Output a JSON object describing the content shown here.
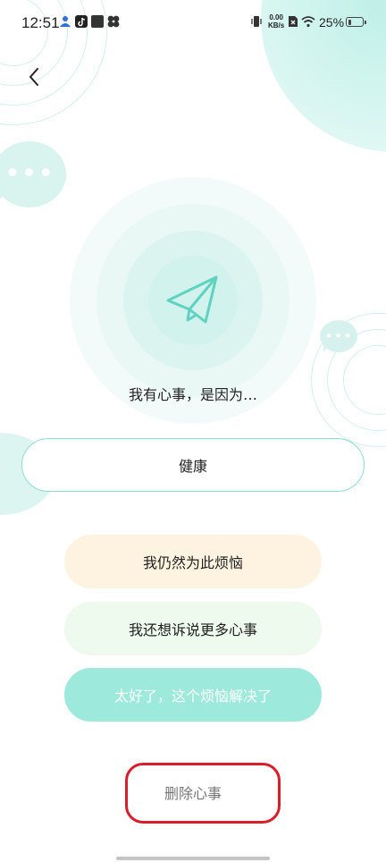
{
  "status_bar": {
    "time": "12:51",
    "net_speed_value": "0.00",
    "net_speed_unit": "KB/s",
    "battery": "25%",
    "battery_level": 0.25,
    "icons": [
      "recruitment-app-icon",
      "tiktok-icon",
      "square-app-icon",
      "pinwheel-app-icon",
      "vibrate-icon",
      "sim-off-icon",
      "wifi-icon",
      "battery-icon"
    ]
  },
  "header": {
    "back_icon": "chevron-left-icon"
  },
  "main": {
    "emblem_icon": "paper-plane-icon",
    "prompt": "我有心事，是因为…",
    "category": "健康",
    "actions": {
      "still_worried": "我仍然为此烦恼",
      "tell_more": "我还想诉说更多心事",
      "resolved": "太好了，这个烦恼解决了"
    },
    "delete_label": "删除心事"
  },
  "colors": {
    "accent": "#8fdcd0",
    "resolved_button": "#9de9dc",
    "still_button": "#fdf3e0",
    "more_button": "#eefaee",
    "highlight": "#d91e2a"
  }
}
